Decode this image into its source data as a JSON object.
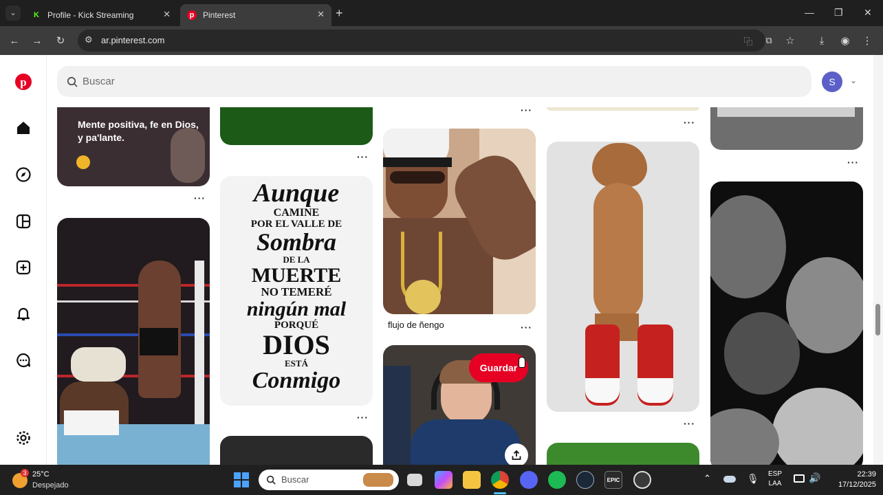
{
  "browser": {
    "tabs": [
      {
        "title": "Profile - Kick Streaming",
        "active": false
      },
      {
        "title": "Pinterest",
        "active": true
      }
    ],
    "url": "ar.pinterest.com"
  },
  "pinterest": {
    "search_placeholder": "Buscar",
    "avatar_letter": "S",
    "pins": {
      "quote_text": "Mente positiva, fe en Dios, y pa'lante.",
      "calligraphy_lines": [
        "Aunque",
        "CAMINE",
        "POR EL VALLE DE",
        "Sombra",
        "DE LA",
        "MUERTE",
        "NO TEMERÉ",
        "ningún mal",
        "PORQUÉ",
        "DIOS",
        "ESTÁ",
        "Conmigo"
      ],
      "captain_title": "flujo de ñengo",
      "save_button": "Guardar"
    },
    "more_glyph": "···"
  },
  "taskbar": {
    "weather_temp": "25°C",
    "weather_desc": "Despejado",
    "weather_badge": "3",
    "search_label": "Buscar",
    "lang_top": "ESP",
    "lang_bottom": "LAA",
    "time": "22:39",
    "date": "17/12/2025"
  }
}
